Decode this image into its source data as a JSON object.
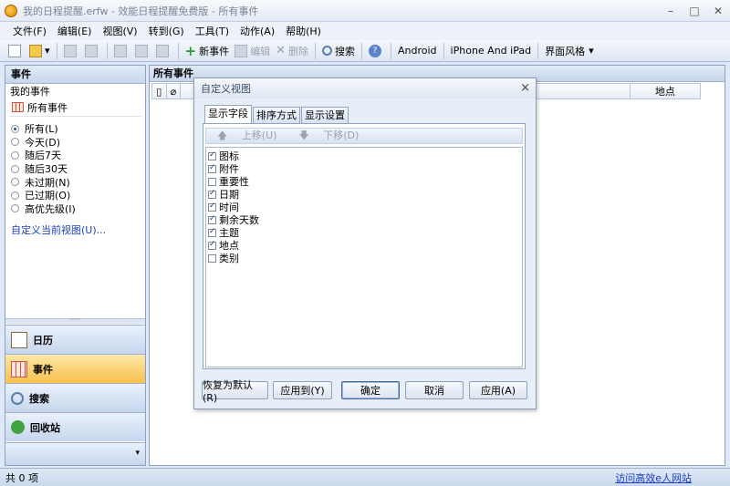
{
  "window": {
    "title": "我的日程提醒.erfw - 效能日程提醒免费版 - 所有事件",
    "minimize": "–",
    "maximize": "□",
    "close": "✕"
  },
  "menu": [
    "文件(F)",
    "编辑(E)",
    "视图(V)",
    "转到(G)",
    "工具(T)",
    "动作(A)",
    "帮助(H)"
  ],
  "toolbar": {
    "new_event": "新事件",
    "edit": "编辑",
    "delete": "删除",
    "search": "搜索",
    "android": "Android",
    "iphone": "iPhone And iPad",
    "theme": "界面风格"
  },
  "left": {
    "header": "事件",
    "my_events": "我的事件",
    "all_events": "所有事件",
    "filters": [
      {
        "label": "所有(L)",
        "selected": true
      },
      {
        "label": "今天(D)",
        "selected": false
      },
      {
        "label": "随后7天",
        "selected": false
      },
      {
        "label": "随后30天",
        "selected": false
      },
      {
        "label": "未过期(N)",
        "selected": false
      },
      {
        "label": "已过期(O)",
        "selected": false
      },
      {
        "label": "高优先级(I)",
        "selected": false
      }
    ],
    "customize_link": "自定义当前视图(U)...",
    "splitter_grip": "······",
    "nav": {
      "calendar": "日历",
      "events": "事件",
      "search": "搜索",
      "recycle": "回收站"
    },
    "nav_more": "▾"
  },
  "main": {
    "header": "所有事件",
    "columns": {
      "icon": "▯",
      "attachment": "⌀",
      "location": "地点"
    }
  },
  "status": {
    "count": "共 0 项",
    "link": "访问高效e人网站"
  },
  "dialog": {
    "title": "自定义视图",
    "close": "×",
    "tabs": [
      "显示字段",
      "排序方式",
      "显示设置"
    ],
    "move_up": "上移(U)",
    "move_down": "下移(D)",
    "fields": [
      {
        "label": "图标",
        "checked": true
      },
      {
        "label": "附件",
        "checked": true
      },
      {
        "label": "重要性",
        "checked": false
      },
      {
        "label": "日期",
        "checked": true
      },
      {
        "label": "时间",
        "checked": true
      },
      {
        "label": "剩余天数",
        "checked": true
      },
      {
        "label": "主题",
        "checked": true
      },
      {
        "label": "地点",
        "checked": true
      },
      {
        "label": "类别",
        "checked": false
      }
    ],
    "buttons": {
      "restore": "恢复为默认(R)",
      "apply_to": "应用到(Y)",
      "ok": "确定",
      "cancel": "取消",
      "apply": "应用(A)"
    }
  },
  "colors": {
    "accent": "#f9c14b",
    "link": "#1a3fbf",
    "pane_border": "#8ba0c0"
  }
}
